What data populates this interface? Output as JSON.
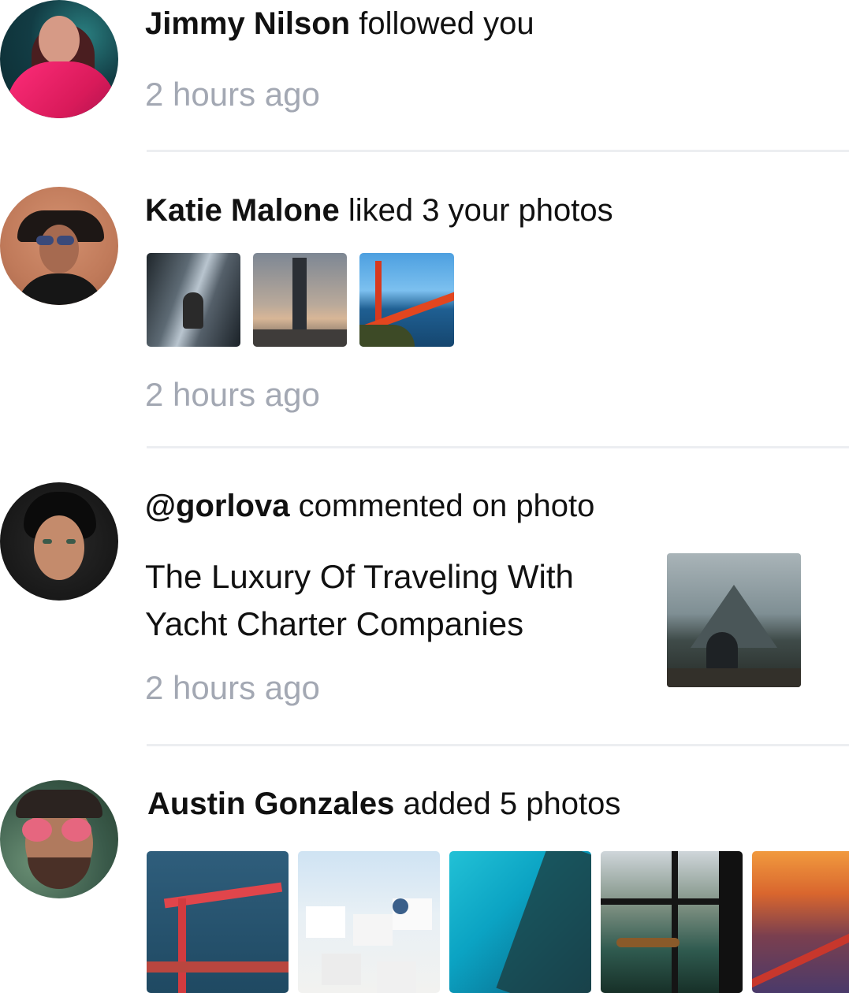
{
  "notifications": [
    {
      "user": "Jimmy Nilson",
      "action": "followed you",
      "time": "2 hours ago"
    },
    {
      "user": "Katie Malone",
      "action": "liked 3 your photos",
      "time": "2 hours ago",
      "photos": [
        "waterfall-photo",
        "tower-photo",
        "golden-gate-photo"
      ]
    },
    {
      "user": "@gorlova",
      "action": "commented on photo",
      "comment": "The Luxury Of Traveling With Yacht Charter Companies",
      "time": "2 hours ago",
      "photo": "mountain-lake-photo"
    },
    {
      "user": "Austin Gonzales",
      "action": "added 5 photos",
      "photos": [
        "bridge-aerial-photo",
        "white-town-photo",
        "turquoise-sea-photo",
        "lake-window-photo",
        "sunset-bridge-photo"
      ]
    }
  ],
  "colors": {
    "time_text": "#a3a8b3",
    "divider": "#eceef1"
  }
}
